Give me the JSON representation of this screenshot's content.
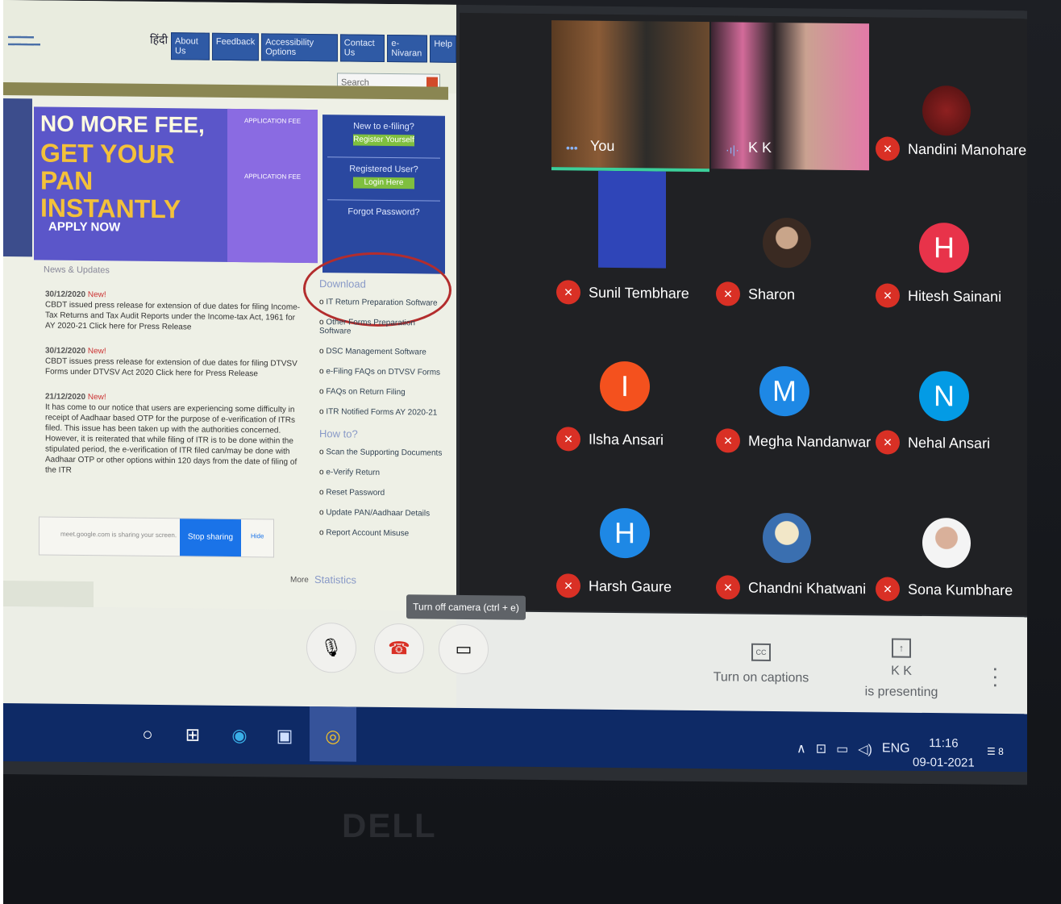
{
  "website": {
    "hindi_link": "हिंदी",
    "nav": [
      "About Us",
      "Feedback",
      "Accessibility Options",
      "Contact Us",
      "e-Nivaran",
      "Help"
    ],
    "search_placeholder": "Search",
    "banner": {
      "line1": "NO MORE FEE,",
      "line2": "GET YOUR PAN INSTANTLY",
      "cta": "APPLY NOW",
      "fee1": "APPLICATION FEE",
      "fee2": "APPLICATION FEE"
    },
    "login": {
      "new": "New to e-filing?",
      "register": "Register Yourself",
      "registered": "Registered User?",
      "login": "Login Here",
      "forgot": "Forgot Password?"
    },
    "news_title": "News & Updates",
    "news": [
      {
        "date": "30/12/2020",
        "tag": "New!",
        "text": "CBDT issued press release for extension of due dates for filing Income-Tax Returns and Tax Audit Reports under the Income-tax Act, 1961 for AY 2020-21 Click here for Press Release"
      },
      {
        "date": "30/12/2020",
        "tag": "New!",
        "text": "CBDT issues press release for extension of due dates for filing DTVSV Forms under DTVSV Act 2020 Click here for Press Release"
      },
      {
        "date": "21/12/2020",
        "tag": "New!",
        "text": "It has come to our notice that users are experiencing some difficulty in receipt of Aadhaar based OTP for the purpose of e-verification of ITRs filed. This issue has been taken up with the authorities concerned. However, it is reiterated that while filing of ITR is to be done within the stipulated period, the e-verification of ITR filed can/may be done with Aadhaar OTP or other options within 120 days from the date of filing of the ITR"
      }
    ],
    "share_popup": {
      "text": "meet.google.com is sharing your screen.",
      "stop": "Stop sharing",
      "hide": "Hide"
    },
    "download_title": "Download",
    "downloads": [
      "IT Return Preparation Software",
      "Other Forms Preparation Software",
      "DSC Management Software",
      "e-Filing FAQs on DTVSV Forms",
      "FAQs on Return Filing",
      "ITR Notified Forms AY 2020-21"
    ],
    "howto_title": "How to?",
    "howto": [
      "Scan the Supporting Documents",
      "e-Verify Return",
      "Reset Password",
      "Update PAN/Aadhaar Details",
      "Report Account Misuse"
    ],
    "more": "More",
    "statistics": "Statistics"
  },
  "meet": {
    "participants": [
      {
        "name": "You",
        "type": "video",
        "muted": false
      },
      {
        "name": "K K",
        "type": "video",
        "muted": false
      },
      {
        "name": "Nandini Manohare",
        "type": "photo",
        "muted": true
      },
      {
        "name": "Sunil Tembhare",
        "type": "blank",
        "muted": true
      },
      {
        "name": "Sharon",
        "type": "photo",
        "muted": true
      },
      {
        "name": "Hitesh Sainani",
        "type": "letter",
        "letter": "H",
        "color": "#e8334a",
        "muted": true
      },
      {
        "name": "Ilsha Ansari",
        "type": "letter",
        "letter": "I",
        "color": "#f4511e",
        "muted": true
      },
      {
        "name": "Megha Nandanwar",
        "type": "letter",
        "letter": "M",
        "color": "#1e88e5",
        "muted": true
      },
      {
        "name": "Nehal Ansari",
        "type": "letter",
        "letter": "N",
        "color": "#039be5",
        "muted": true
      },
      {
        "name": "Harsh Gaure",
        "type": "letter",
        "letter": "H",
        "color": "#1e88e5",
        "muted": true
      },
      {
        "name": "Chandni Khatwani",
        "type": "photo",
        "muted": true
      },
      {
        "name": "Sona Kumbhare",
        "type": "photo",
        "muted": true
      }
    ],
    "tooltip": "Turn off camera (ctrl + e)",
    "captions": "Turn on captions",
    "presenter": "K K",
    "presenting": "is presenting"
  },
  "taskbar": {
    "lang": "ENG",
    "time": "11:16",
    "date": "09-01-2021",
    "notifications": "8"
  },
  "monitor_brand": "DELL"
}
